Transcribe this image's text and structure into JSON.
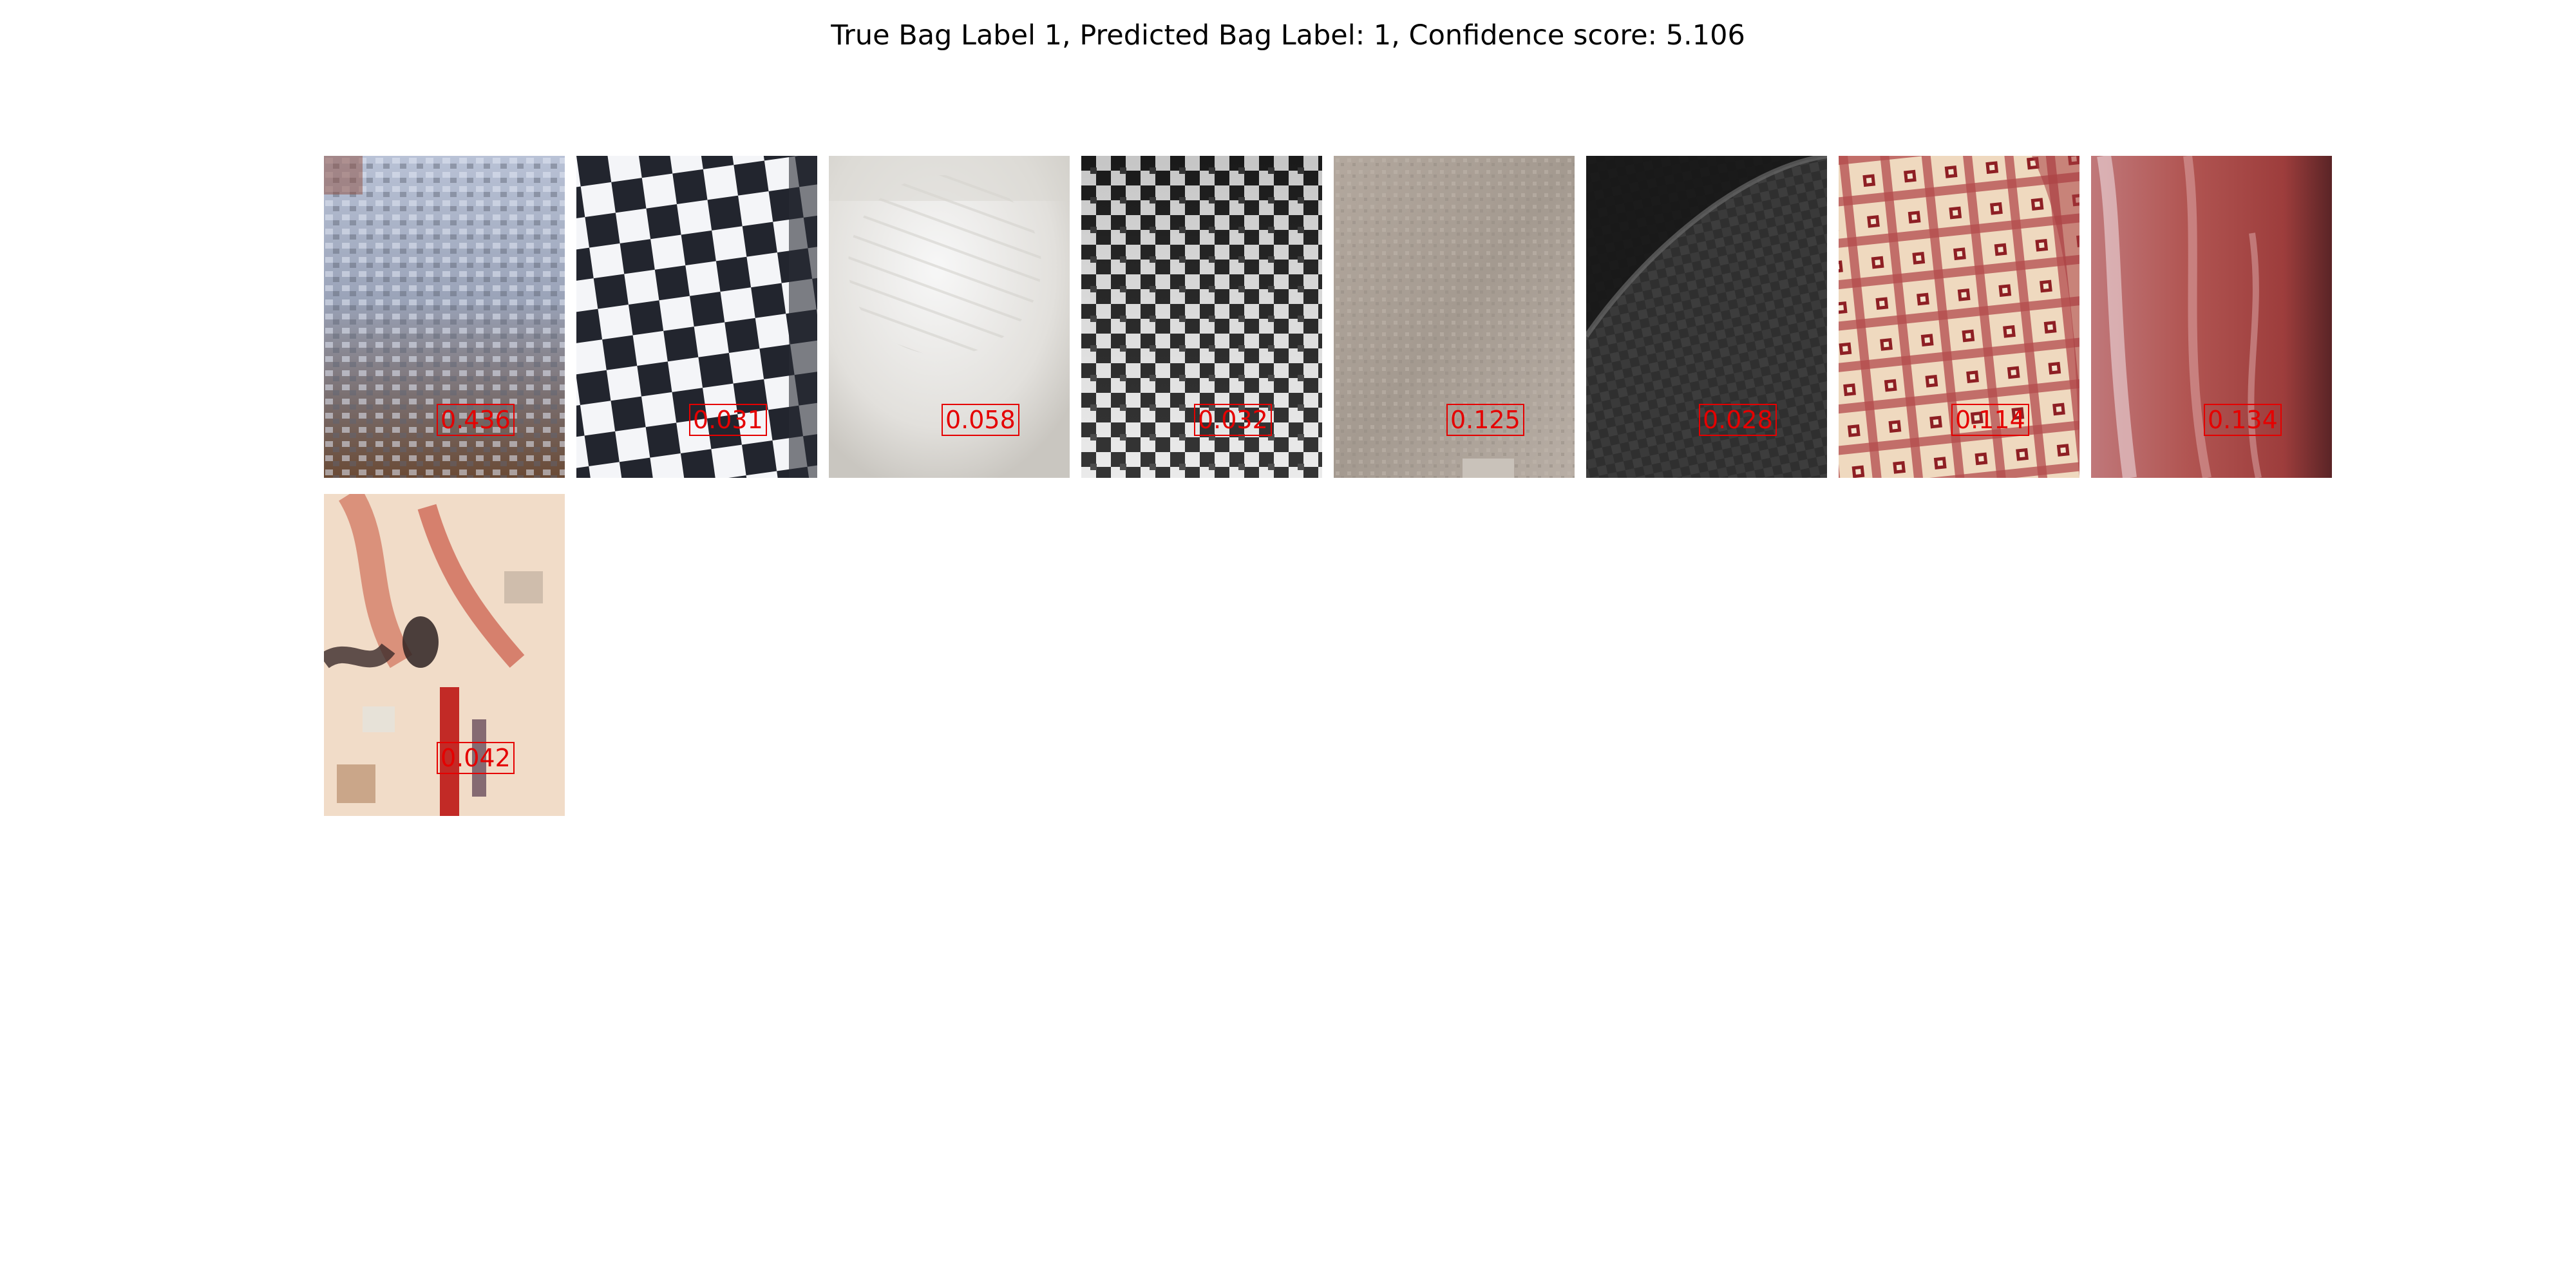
{
  "figure": {
    "title": "True Bag Label 1, Predicted Bag Label: 1, Confidence score: 5.106"
  },
  "instances": [
    {
      "score": "0.436",
      "texture": "grey-knit-fabric"
    },
    {
      "score": "0.031",
      "texture": "black-white-checkerboard"
    },
    {
      "score": "0.058",
      "texture": "white-quilted-fabric"
    },
    {
      "score": "0.032",
      "texture": "black-white-houndstooth"
    },
    {
      "score": "0.125",
      "texture": "beige-felt"
    },
    {
      "score": "0.028",
      "texture": "dark-grey-check"
    },
    {
      "score": "0.114",
      "texture": "red-cream-gingham"
    },
    {
      "score": "0.134",
      "texture": "red-glossy-surface"
    },
    {
      "score": "0.042",
      "texture": "colorful-pastel-print"
    }
  ],
  "colors": {
    "score_text": "#e50000",
    "score_box": "#e50000",
    "background": "#ffffff"
  }
}
